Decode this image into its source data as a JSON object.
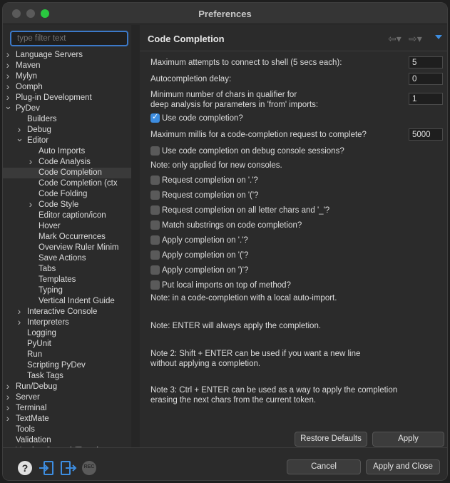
{
  "window": {
    "title": "Preferences"
  },
  "filter": {
    "placeholder": "type filter text"
  },
  "tree": [
    {
      "label": "Language Servers",
      "depth": 0,
      "arrow": "right"
    },
    {
      "label": "Maven",
      "depth": 0,
      "arrow": "right"
    },
    {
      "label": "Mylyn",
      "depth": 0,
      "arrow": "right"
    },
    {
      "label": "Oomph",
      "depth": 0,
      "arrow": "right"
    },
    {
      "label": "Plug-in Development",
      "depth": 0,
      "arrow": "right"
    },
    {
      "label": "PyDev",
      "depth": 0,
      "arrow": "down"
    },
    {
      "label": "Builders",
      "depth": 1,
      "arrow": ""
    },
    {
      "label": "Debug",
      "depth": 1,
      "arrow": "right"
    },
    {
      "label": "Editor",
      "depth": 1,
      "arrow": "down"
    },
    {
      "label": "Auto Imports",
      "depth": 2,
      "arrow": ""
    },
    {
      "label": "Code Analysis",
      "depth": 2,
      "arrow": "right"
    },
    {
      "label": "Code Completion",
      "depth": 2,
      "arrow": "",
      "selected": true
    },
    {
      "label": "Code Completion (ctx",
      "depth": 2,
      "arrow": ""
    },
    {
      "label": "Code Folding",
      "depth": 2,
      "arrow": ""
    },
    {
      "label": "Code Style",
      "depth": 2,
      "arrow": "right"
    },
    {
      "label": "Editor caption/icon",
      "depth": 2,
      "arrow": ""
    },
    {
      "label": "Hover",
      "depth": 2,
      "arrow": ""
    },
    {
      "label": "Mark Occurrences",
      "depth": 2,
      "arrow": ""
    },
    {
      "label": "Overview Ruler Minim",
      "depth": 2,
      "arrow": ""
    },
    {
      "label": "Save Actions",
      "depth": 2,
      "arrow": ""
    },
    {
      "label": "Tabs",
      "depth": 2,
      "arrow": ""
    },
    {
      "label": "Templates",
      "depth": 2,
      "arrow": ""
    },
    {
      "label": "Typing",
      "depth": 2,
      "arrow": ""
    },
    {
      "label": "Vertical Indent Guide",
      "depth": 2,
      "arrow": ""
    },
    {
      "label": "Interactive Console",
      "depth": 1,
      "arrow": "right"
    },
    {
      "label": "Interpreters",
      "depth": 1,
      "arrow": "right"
    },
    {
      "label": "Logging",
      "depth": 1,
      "arrow": ""
    },
    {
      "label": "PyUnit",
      "depth": 1,
      "arrow": ""
    },
    {
      "label": "Run",
      "depth": 1,
      "arrow": ""
    },
    {
      "label": "Scripting PyDev",
      "depth": 1,
      "arrow": ""
    },
    {
      "label": "Task Tags",
      "depth": 1,
      "arrow": ""
    },
    {
      "label": "Run/Debug",
      "depth": 0,
      "arrow": "right"
    },
    {
      "label": "Server",
      "depth": 0,
      "arrow": "right"
    },
    {
      "label": "Terminal",
      "depth": 0,
      "arrow": "right"
    },
    {
      "label": "TextMate",
      "depth": 0,
      "arrow": "right"
    },
    {
      "label": "Tools",
      "depth": 0,
      "arrow": ""
    },
    {
      "label": "Validation",
      "depth": 0,
      "arrow": ""
    },
    {
      "label": "Version Control (Team)",
      "depth": 0,
      "arrow": "right"
    }
  ],
  "page": {
    "title": "Code Completion",
    "max_attempts_label": "Maximum attempts to connect to shell (5 secs each):",
    "max_attempts_value": "5",
    "autocomplete_delay_label": "Autocompletion delay:",
    "autocomplete_delay_value": "0",
    "min_chars_label_1": "Minimum number of chars in qualifier for",
    "min_chars_label_2": "deep analysis for parameters in 'from' imports:",
    "min_chars_value": "1",
    "use_code_completion": {
      "label": "Use code completion?",
      "checked": true
    },
    "max_millis_label": "Maximum millis for a code-completion request to complete?",
    "max_millis_value": "5000",
    "use_debug_console": {
      "label": "Use code completion on debug console sessions?",
      "checked": false
    },
    "note_consoles": "Note: only applied for new consoles.",
    "checkboxes": [
      {
        "label": "Request completion on '.'?",
        "checked": false
      },
      {
        "label": "Request completion on '('?",
        "checked": false
      },
      {
        "label": "Request completion on all letter chars and '_'?",
        "checked": false
      },
      {
        "label": "Match substrings on code completion?",
        "checked": false
      },
      {
        "label": "Apply completion on '.'?",
        "checked": false
      },
      {
        "label": "Apply completion on '('?",
        "checked": false
      },
      {
        "label": "Apply completion on ')'?",
        "checked": false
      },
      {
        "label": "Put local imports on top of method?",
        "checked": false
      }
    ],
    "note_local_import": "Note: in a code-completion with a local auto-import.",
    "note_enter": "Note: ENTER will always apply the completion.",
    "note2_line1": "Note 2: Shift + ENTER can be used if you want a new line",
    "note2_line2": "without applying a completion.",
    "note3_line1": "Note 3: Ctrl + ENTER can be used as a way to apply the completion",
    "note3_line2": "erasing the next chars from the current token.",
    "restore_defaults": "Restore Defaults",
    "apply": "Apply"
  },
  "footer": {
    "cancel": "Cancel",
    "apply_and_close": "Apply and Close",
    "rec_label": "REC"
  },
  "colors": {
    "accent": "#3d8de0",
    "background": "#2b2b2b",
    "text": "#dcdcdc"
  }
}
